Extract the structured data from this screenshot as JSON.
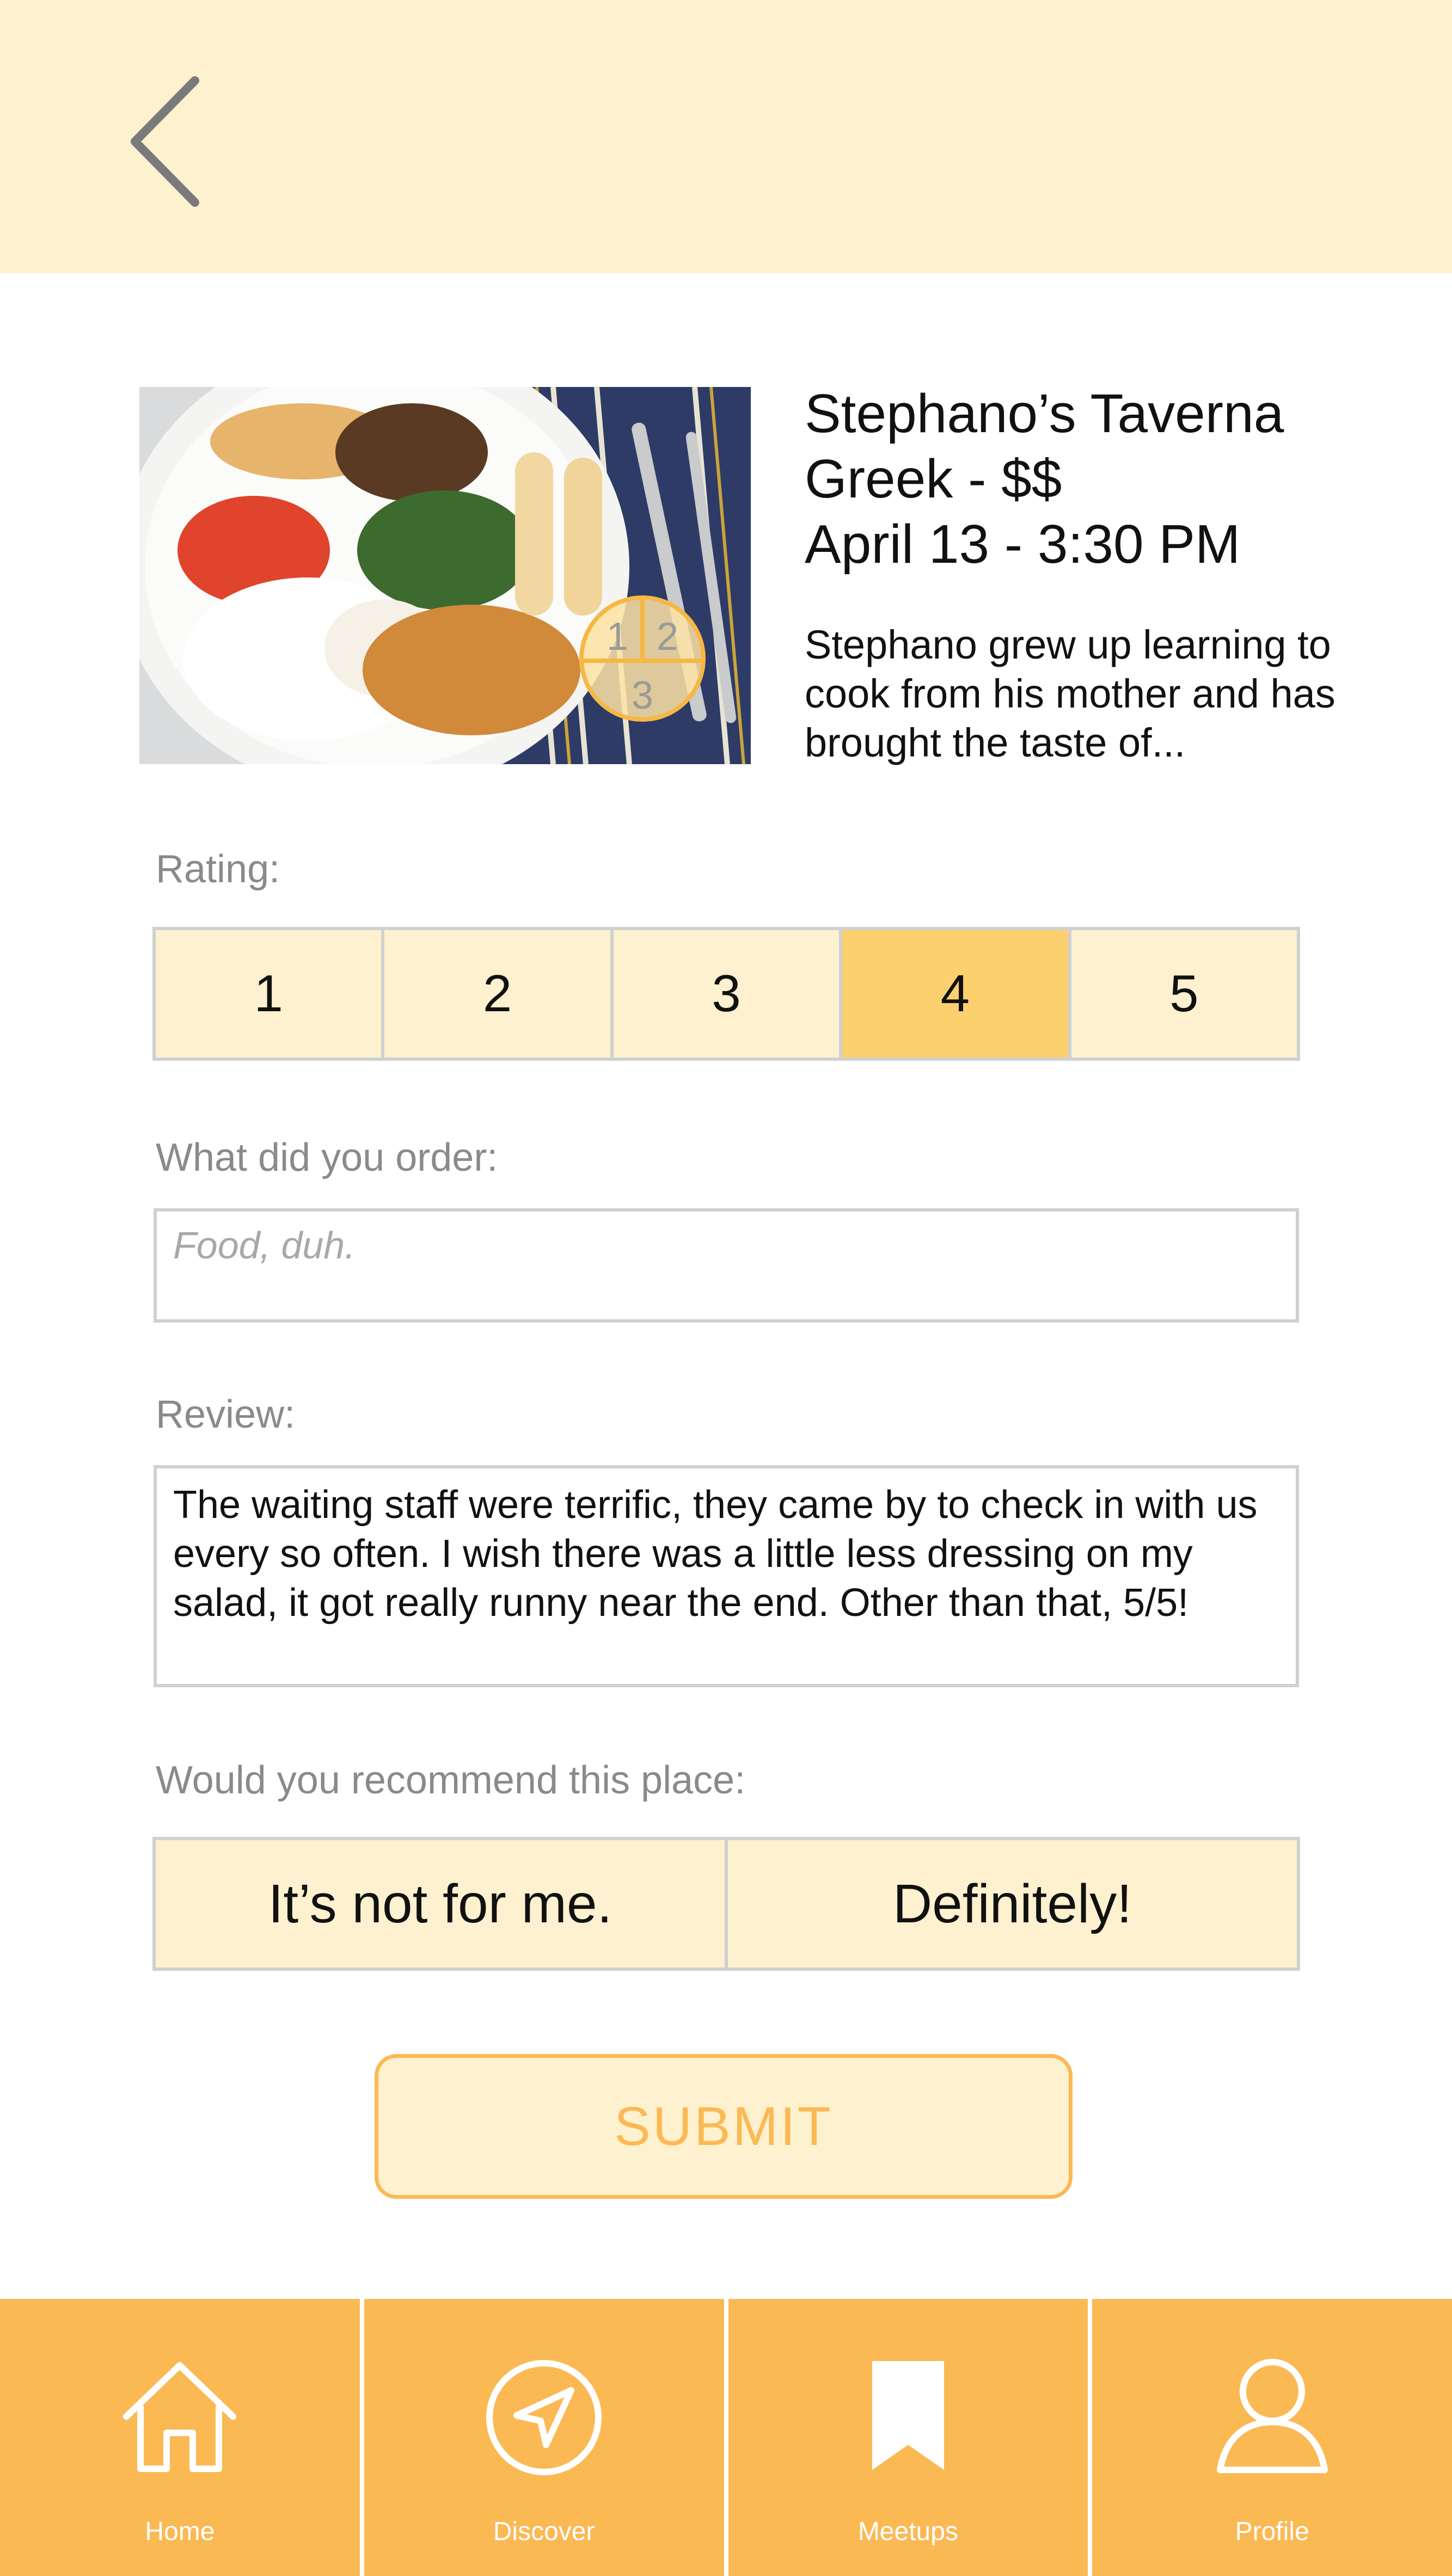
{
  "header": {
    "back_icon": "chevron-left-icon"
  },
  "restaurant": {
    "name": "Stephano’s Taverna",
    "category": "Greek - $$",
    "datetime": "April 13 - 3:30 PM",
    "description": "Stephano grew up learning to cook from his mother and has brought the taste of...",
    "portion_badge": {
      "top_left": "1",
      "top_right": "2",
      "bottom": "3"
    }
  },
  "rating": {
    "label": "Rating:",
    "options": [
      "1",
      "2",
      "3",
      "4",
      "5"
    ],
    "selected": "4",
    "selected_color": "#fdd06f"
  },
  "order": {
    "label": "What did you order:",
    "placeholder": "Food, duh."
  },
  "review": {
    "label": "Review:",
    "value": "The waiting staff were terrific, they came by to check in with us every so often. I wish there was a little less dressing on my salad, it got really runny near the end. Other than that, 5/5!"
  },
  "recommend": {
    "label": "Would you recommend this place:",
    "no_label": "It’s not for me.",
    "yes_label": "Definitely!"
  },
  "submit_label": "SUBMIT",
  "nav": {
    "home": {
      "label": "Home",
      "icon": "home-icon"
    },
    "discover": {
      "label": "Discover",
      "icon": "navigation-arrow-icon"
    },
    "meetups": {
      "label": "Meetups",
      "icon": "bookmark-icon"
    },
    "profile": {
      "label": "Profile",
      "icon": "user-icon"
    }
  },
  "colors": {
    "accent": "#fbb954",
    "header_bg": "#fef1cf",
    "option_bg": "#fef1cf",
    "border": "#d0d0d0"
  }
}
